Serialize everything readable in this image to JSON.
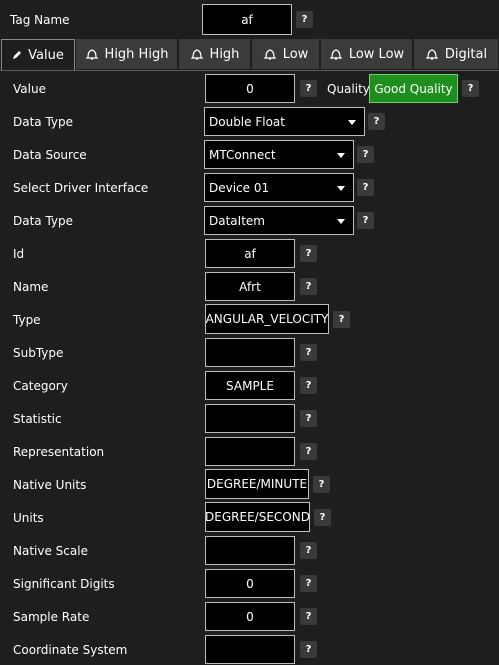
{
  "tag": {
    "label": "Tag Name",
    "value": "af"
  },
  "tabs": [
    {
      "label": "Value",
      "icon": "pencil-icon"
    },
    {
      "label": "High High",
      "icon": "bell-icon"
    },
    {
      "label": "High",
      "icon": "bell-icon"
    },
    {
      "label": "Low",
      "icon": "bell-icon"
    },
    {
      "label": "Low Low",
      "icon": "bell-icon"
    },
    {
      "label": "Digital",
      "icon": "bell-icon"
    }
  ],
  "help_glyph": "?",
  "value_row": {
    "label": "Value",
    "value": "0",
    "quality_label": "Quality",
    "quality_value": "Good Quality",
    "quality_color": "#1e8f1e"
  },
  "data_type": {
    "label": "Data Type",
    "value": "Double Float"
  },
  "data_source": {
    "label": "Data Source",
    "value": "MTConnect"
  },
  "driver_interface": {
    "label": "Select Driver Interface",
    "value": "Device 01"
  },
  "data_type2": {
    "label": "Data Type",
    "value": "DataItem"
  },
  "fields": [
    {
      "label": "Id",
      "value": "af"
    },
    {
      "label": "Name",
      "value": "Afrt"
    },
    {
      "label": "Type",
      "value": "ANGULAR_VELOCITY"
    },
    {
      "label": "SubType",
      "value": ""
    },
    {
      "label": "Category",
      "value": "SAMPLE"
    },
    {
      "label": "Statistic",
      "value": ""
    },
    {
      "label": "Representation",
      "value": ""
    },
    {
      "label": "Native Units",
      "value": "DEGREE/MINUTE"
    },
    {
      "label": "Units",
      "value": "DEGREE/SECOND"
    },
    {
      "label": "Native Scale",
      "value": ""
    },
    {
      "label": "Significant Digits",
      "value": "0"
    },
    {
      "label": "Sample Rate",
      "value": "0"
    },
    {
      "label": "Coordinate System",
      "value": ""
    }
  ]
}
